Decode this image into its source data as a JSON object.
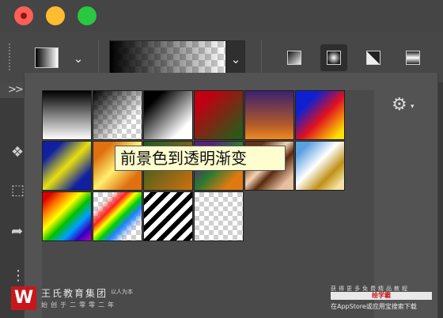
{
  "window": {
    "controls": [
      {
        "name": "close",
        "color": "#fe5f57"
      },
      {
        "name": "minimize",
        "color": "#febc2e"
      },
      {
        "name": "zoom",
        "color": "#28c840"
      }
    ]
  },
  "toolbar": {
    "gradient_types": [
      "linear-gradient-icon",
      "radial-gradient-icon",
      "angle-gradient-icon",
      "reflected-gradient-icon"
    ],
    "selected_type": "radial-gradient-icon"
  },
  "tools": {
    "expand_glyph": ">>",
    "icons": [
      "move-icon",
      "marquee-icon",
      "lasso-icon",
      "quick-select-icon"
    ]
  },
  "gradient_panel": {
    "presets": [
      {
        "id": "black-white"
      },
      {
        "id": "black-transparent"
      },
      {
        "id": "black-to-white"
      },
      {
        "id": "red-green"
      },
      {
        "id": "violet-orange"
      },
      {
        "id": "blue-red-yellow"
      },
      {
        "id": "blue-yellow-blue"
      },
      {
        "id": "orange-yellow-orange"
      },
      {
        "id": "green-orange"
      },
      {
        "id": "violet-green-orange"
      },
      {
        "id": "copper"
      },
      {
        "id": "chrome"
      },
      {
        "id": "spectrum"
      },
      {
        "id": "transparent-rainbow"
      },
      {
        "id": "transparent-stripes"
      },
      {
        "id": "foreground-to-transparent"
      }
    ],
    "settings_icon": "gear-icon",
    "tooltip": "前景色到透明渐变"
  },
  "watermark": {
    "logo_glyph": "W",
    "brand_text": "王氏教育集团",
    "slogan": "以人为本",
    "founded_text": "始创于二零零二年",
    "right_line1": "获得更多免费精品教程",
    "right_line2": "绘学霸",
    "right_line3": "在AppStore或应用宝搜索下载"
  }
}
